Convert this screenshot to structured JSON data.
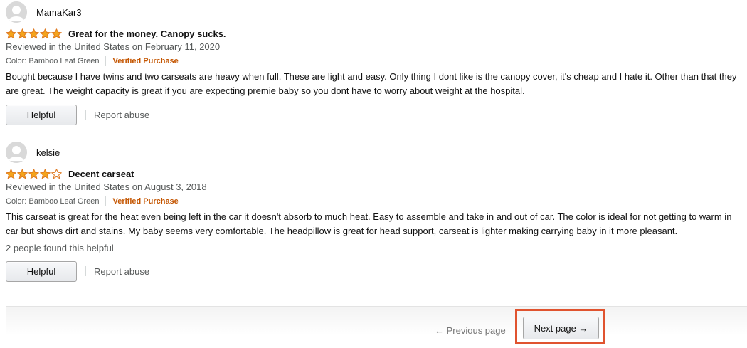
{
  "reviews": [
    {
      "profile_name": "MamaKar3",
      "rating": 5,
      "rating_max": 5,
      "title": "Great for the money. Canopy sucks.",
      "date": "Reviewed in the United States on February 11, 2020",
      "variant": "Color: Bamboo Leaf Green",
      "verified": "Verified Purchase",
      "body": "Bought because I have twins and two carseats are heavy when full. These are light and easy. Only thing I dont like is the canopy cover, it's cheap and I hate it. Other than that they are great. The weight capacity is great if you are expecting premie baby so you dont have to worry about weight at the hospital.",
      "helpful_count": "",
      "helpful_label": "Helpful",
      "report_label": "Report abuse"
    },
    {
      "profile_name": "kelsie",
      "rating": 4,
      "rating_max": 5,
      "title": "Decent carseat",
      "date": "Reviewed in the United States on August 3, 2018",
      "variant": "Color: Bamboo Leaf Green",
      "verified": "Verified Purchase",
      "body": "This carseat is great for the heat even being left in the car it doesn't absorb to much heat. Easy to assemble and take in and out of car. The color is ideal for not getting to warm in car but shows dirt and stains. My baby seems very comfortable. The headpillow is great for head support, carseat is lighter making carrying baby in it more pleasant.",
      "helpful_count": "2 people found this helpful",
      "helpful_label": "Helpful",
      "report_label": "Report abuse"
    }
  ],
  "pagination": {
    "previous_label": "← Previous page",
    "next_label": "Next page →"
  },
  "colors": {
    "star_filled": "#f4a41c",
    "star_empty": "#ffffff",
    "verified": "#c45500",
    "highlight": "#e0532f"
  },
  "icons": {
    "avatar": "default-avatar-icon",
    "star": "star-icon"
  }
}
